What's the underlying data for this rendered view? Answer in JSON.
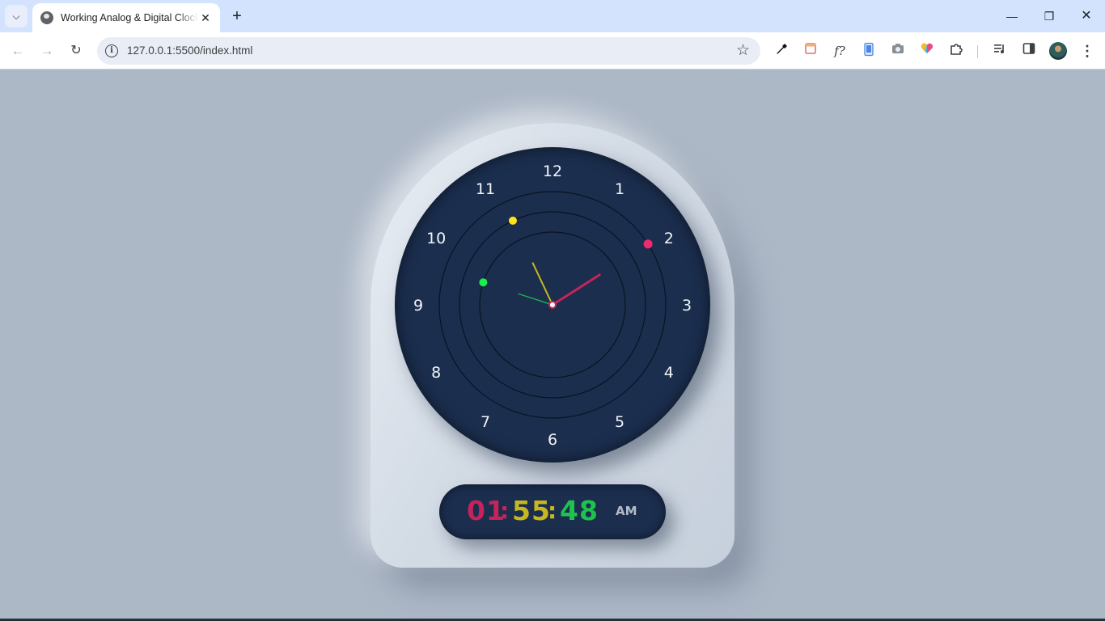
{
  "browser": {
    "tab": {
      "title": "Working Analog & Digital Clock"
    },
    "url": "127.0.0.1:5500/index.html",
    "icons": [
      "tab-search-icon",
      "globe-icon",
      "close-icon",
      "plus-icon",
      "minimize-icon",
      "restore-icon",
      "close-window-icon",
      "back-arrow-icon",
      "forward-arrow-icon",
      "reload-icon",
      "info-icon",
      "star-icon",
      "eyedropper-icon",
      "calendar-icon",
      "font-detect-icon",
      "device-icon",
      "camera-icon",
      "heart-icon",
      "puzzle-icon",
      "media-icon",
      "sidepanel-icon",
      "avatar",
      "kebab-menu-icon"
    ]
  },
  "clock": {
    "numerals": [
      "12",
      "1",
      "2",
      "3",
      "4",
      "5",
      "6",
      "7",
      "8",
      "9",
      "10",
      "11"
    ],
    "time": {
      "hours": "01",
      "minutes": "55",
      "seconds": "48",
      "ampm": "AM",
      "separator": ":"
    },
    "colors": {
      "hour": "#c4245a",
      "minute": "#c7b820",
      "second": "#1ec24e",
      "face": "#1b2e4e",
      "case": "#d3dbe5",
      "background": "#adb8c7"
    }
  }
}
